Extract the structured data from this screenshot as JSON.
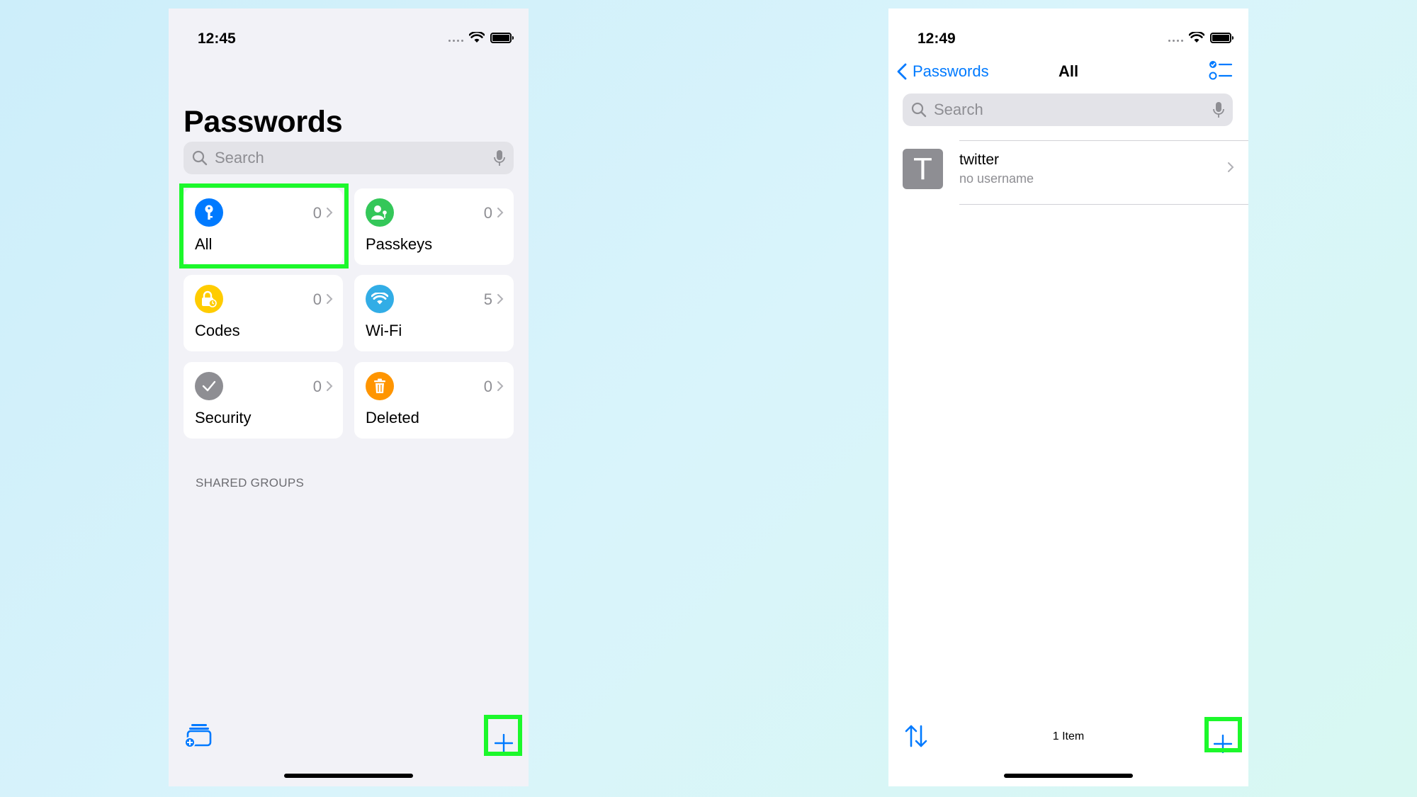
{
  "left_phone": {
    "status_time": "12:45",
    "title": "Passwords",
    "search_placeholder": "Search",
    "tiles": [
      {
        "label": "All",
        "count": "0",
        "icon": "key-icon",
        "color": "#007aff"
      },
      {
        "label": "Passkeys",
        "count": "0",
        "icon": "person-key-icon",
        "color": "#34c759"
      },
      {
        "label": "Codes",
        "count": "0",
        "icon": "lock-code-icon",
        "color": "#ffcc00"
      },
      {
        "label": "Wi-Fi",
        "count": "5",
        "icon": "wifi-icon",
        "color": "#32ade6"
      },
      {
        "label": "Security",
        "count": "0",
        "icon": "checkmark-icon",
        "color": "#8e8e93"
      },
      {
        "label": "Deleted",
        "count": "0",
        "icon": "trash-icon",
        "color": "#ff9500"
      }
    ],
    "section_header": "SHARED GROUPS",
    "toolbar": {
      "new_group_icon": "new-group-icon",
      "add_icon": "plus-icon"
    }
  },
  "right_phone": {
    "status_time": "12:49",
    "nav": {
      "back_label": "Passwords",
      "title": "All",
      "menu_icon": "checklist-icon"
    },
    "search_placeholder": "Search",
    "items": [
      {
        "initial": "T",
        "title": "twitter",
        "subtitle": "no username"
      }
    ],
    "toolbar": {
      "count_label": "1 Item",
      "sort_icon": "sort-arrows-icon",
      "add_icon": "plus-icon"
    }
  },
  "colors": {
    "accent": "#007aff",
    "highlight": "#1cf82b",
    "background_group": "#f2f2f7"
  }
}
